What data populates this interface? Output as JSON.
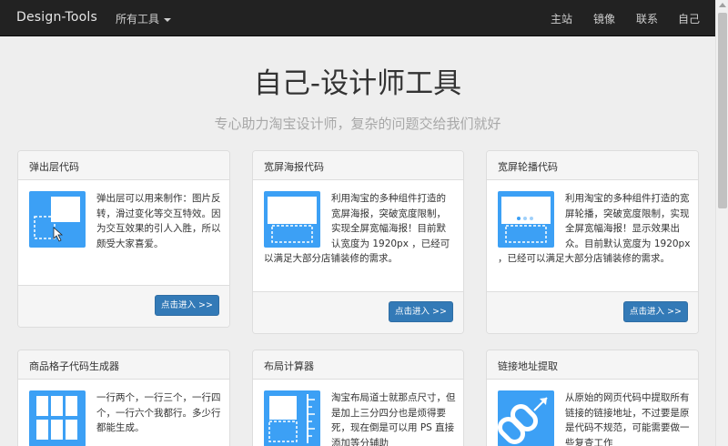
{
  "navbar": {
    "brand": "Design-Tools",
    "tools_menu": "所有工具",
    "links": [
      "主站",
      "镜像",
      "联系",
      "自己"
    ]
  },
  "hero": {
    "title": "自己-设计师工具",
    "subtitle": "专心助力淘宝设计师，复杂的问题交给我们就好"
  },
  "cards": [
    {
      "title": "弹出层代码",
      "icon": "popup-layer-icon",
      "description": "弹出层可以用来制作：图片反转，滑过变化等交互特效。因为交互效果的引人入胜，所以颇受大家喜爱。",
      "button": "点击进入 >>"
    },
    {
      "title": "宽屏海报代码",
      "icon": "wide-poster-icon",
      "description": "利用淘宝的多种组件打造的宽屏海报，突破宽度限制，实现全屏宽幅海报！目前默认宽度为 1920px ，已经可以满足大部分店铺装修的需求。",
      "button": "点击进入 >>"
    },
    {
      "title": "宽屏轮播代码",
      "icon": "wide-carousel-icon",
      "description": "利用淘宝的多种组件打造的宽屏轮播，突破宽度限制，实现全屏宽幅海报！显示效果出众。目前默认宽度为 1920px ，已经可以满足大部分店铺装修的需求。",
      "button": "点击进入 >>"
    },
    {
      "title": "商品格子代码生成器",
      "icon": "product-grid-icon",
      "description": "一行两个，一行三个，一行四个，一行六个我都行。多少行都能生成。"
    },
    {
      "title": "布局计算器",
      "icon": "layout-ruler-icon",
      "description": "淘宝布局道士就那点尺寸，但是加上三分四分也是烦得要死，现在倒是可以用 PS 直接添加等分辅助"
    },
    {
      "title": "链接地址提取",
      "icon": "link-chain-icon",
      "description": "从原始的网页代码中提取所有链接的链接地址，不过要是原是代码不规范，可能需要做一些复查工作"
    }
  ]
}
